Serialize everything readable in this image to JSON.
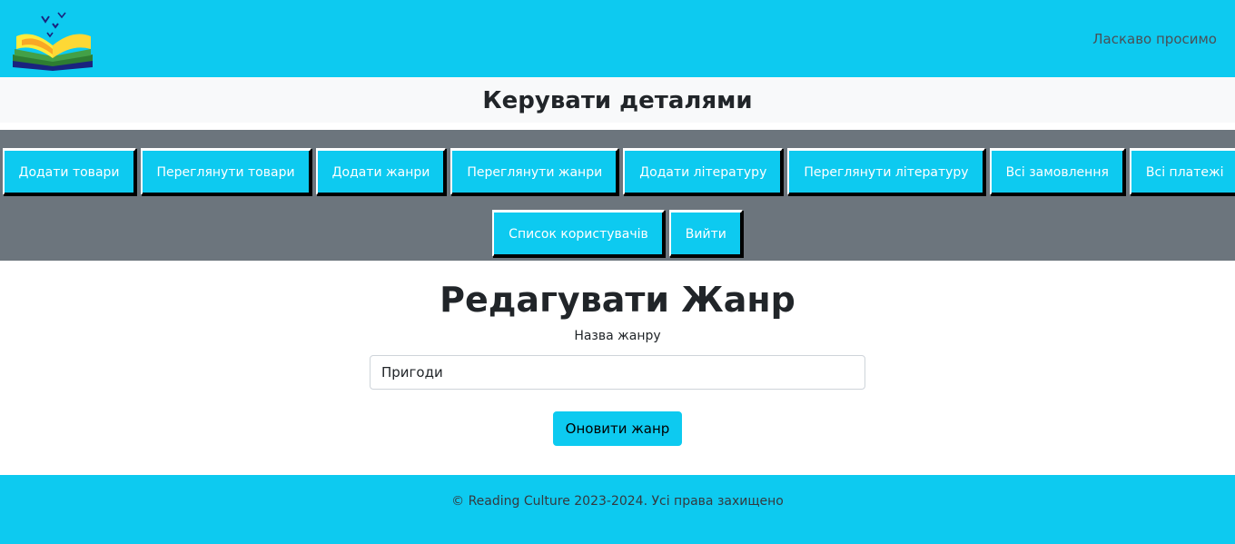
{
  "header": {
    "logo_icon": "open-book-logo-icon",
    "welcome_text": "Ласкаво просимо"
  },
  "manage": {
    "title": "Керувати деталями"
  },
  "admin_nav": {
    "row1": [
      {
        "label": "Додати товари"
      },
      {
        "label": "Переглянути товари"
      },
      {
        "label": "Додати жанри"
      },
      {
        "label": "Переглянути жанри"
      },
      {
        "label": "Додати літературу"
      },
      {
        "label": "Переглянути літературу"
      },
      {
        "label": "Всі замовлення"
      },
      {
        "label": "Всі платежі"
      }
    ],
    "row2": [
      {
        "label": "Список користувачів"
      },
      {
        "label": "Вийти"
      }
    ]
  },
  "main": {
    "title": "Редагувати Жанр",
    "field_label": "Назва жанру",
    "genre_value": "Пригоди",
    "submit_label": "Оновити жанр"
  },
  "footer": {
    "copyright": "© Reading Culture 2023-2024. Усі права захищено"
  },
  "colors": {
    "accent": "#0dcaf0",
    "nav_background": "#6c757d",
    "manage_background": "#f8f9fa"
  }
}
